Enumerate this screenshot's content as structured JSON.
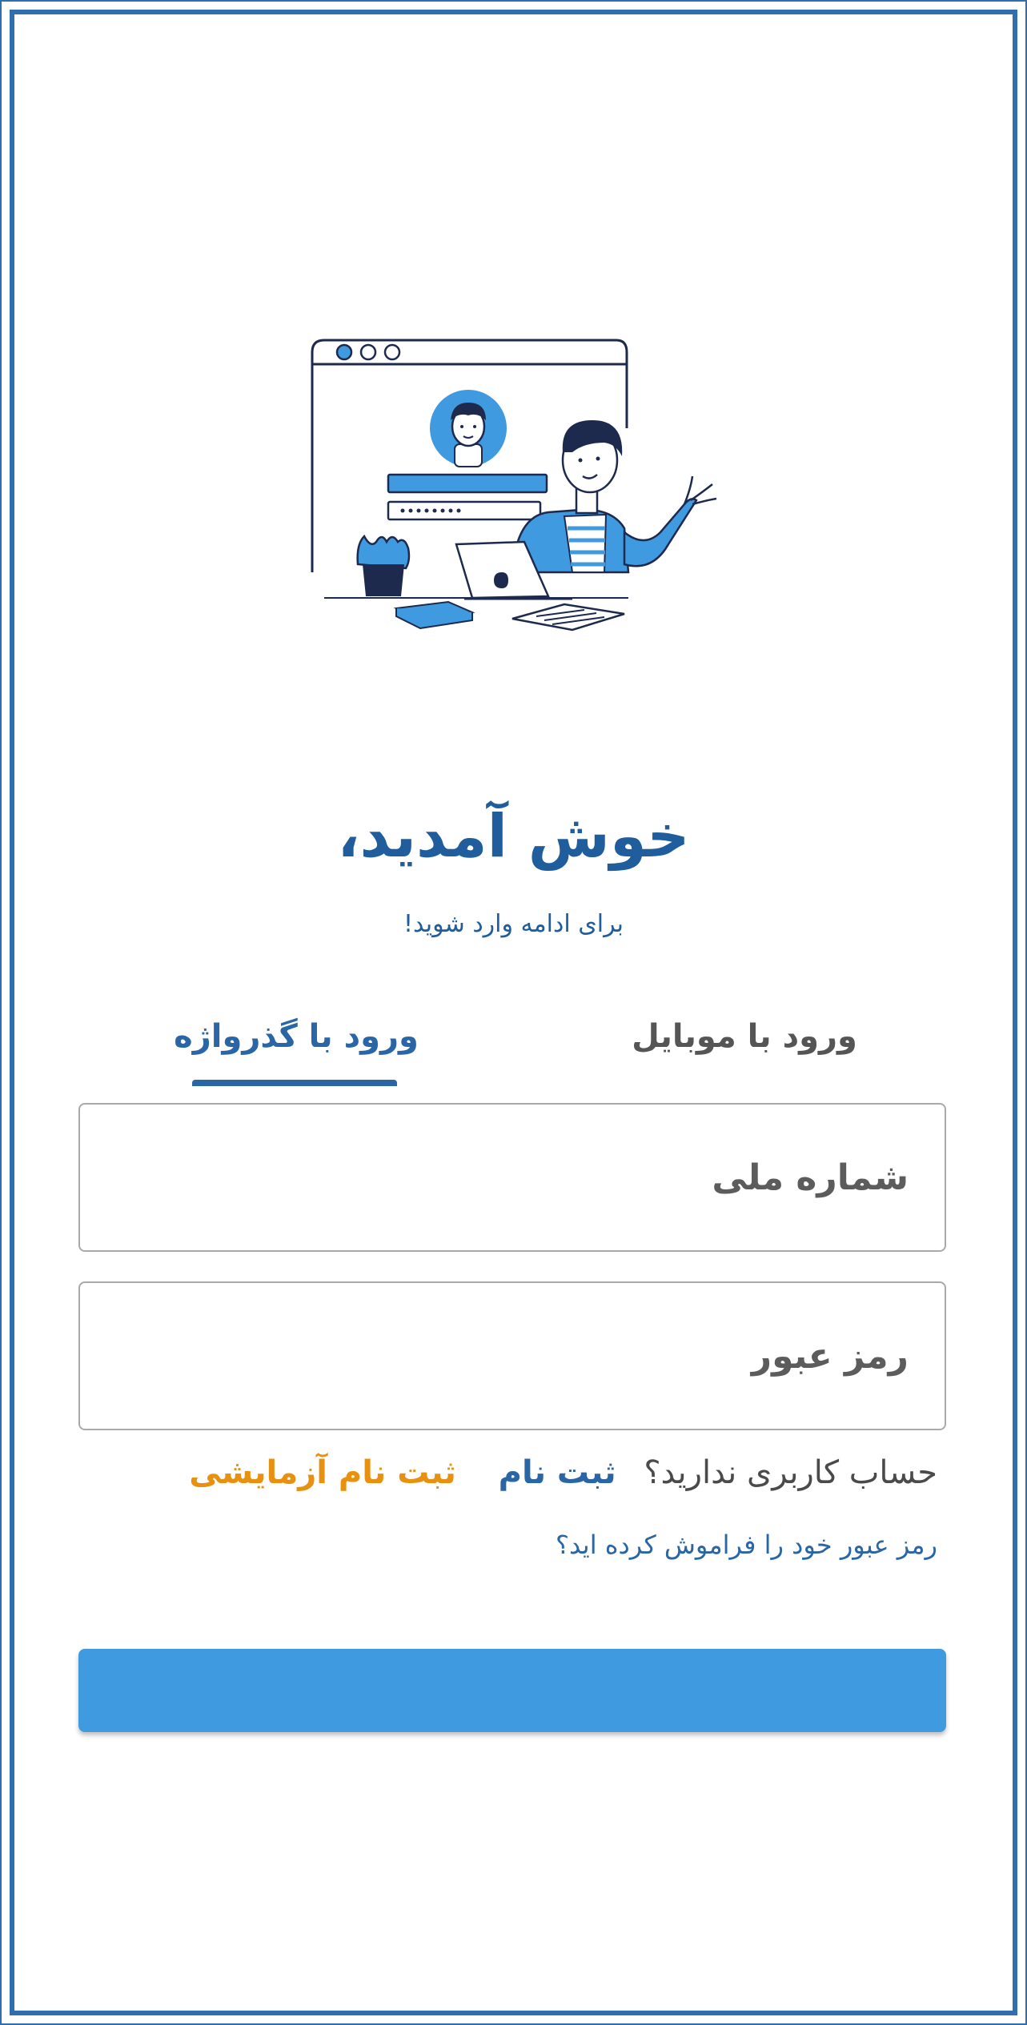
{
  "header": {
    "title": "خوش آمدید،",
    "subtitle": "برای ادامه وارد شوید!"
  },
  "tabs": [
    {
      "label": "ورود با گذرواژه",
      "active": true
    },
    {
      "label": "ورود با موبایل",
      "active": false
    }
  ],
  "form": {
    "national_id_placeholder": "شماره ملی",
    "national_id_value": "",
    "password_placeholder": "رمز عبور",
    "password_value": "",
    "password_mask": "••••••••",
    "submit_label": ""
  },
  "signup": {
    "question": "حساب کاربری ندارید؟",
    "register_label": "ثبت نام",
    "trial_label": "ثبت نام آزمایشی"
  },
  "forgot_password": "رمز عبور خود را فراموش کرده اید؟",
  "colors": {
    "primary": "#2a66a6",
    "title": "#1f5d9c",
    "accent": "#e8900f",
    "button": "#3f9ae0",
    "frame": "#2f6fb0"
  }
}
